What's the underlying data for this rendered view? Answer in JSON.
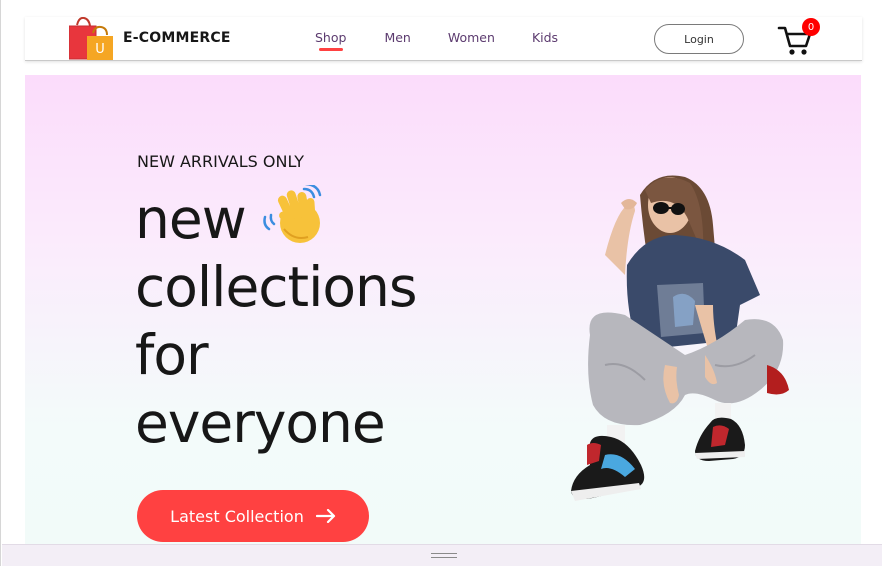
{
  "brand": {
    "name": "E-COMMERCE",
    "logo_letter": "U",
    "logo_icon": "shopping-bags-icon"
  },
  "nav": {
    "links": [
      {
        "label": "Shop",
        "active": true
      },
      {
        "label": "Men",
        "active": false
      },
      {
        "label": "Women",
        "active": false
      },
      {
        "label": "Kids",
        "active": false
      }
    ],
    "login_label": "Login",
    "cart_count": "0",
    "cart_icon": "cart-icon"
  },
  "hero": {
    "eyebrow": "NEW ARRIVALS ONLY",
    "headline": [
      "new",
      "collections",
      "for",
      "everyone"
    ],
    "hand_icon": "waving-hand-icon",
    "cta_label": "Latest Collection",
    "cta_icon": "arrow-right-icon",
    "image": "hero-model-image"
  },
  "colors": {
    "accent": "#ff4141",
    "nav_text": "#5c3b6f",
    "text_dark": "#171717",
    "badge": "#ff0000",
    "hero_gradient_top": "#fbdcfb",
    "hero_gradient_bottom": "#f2fbf9"
  }
}
